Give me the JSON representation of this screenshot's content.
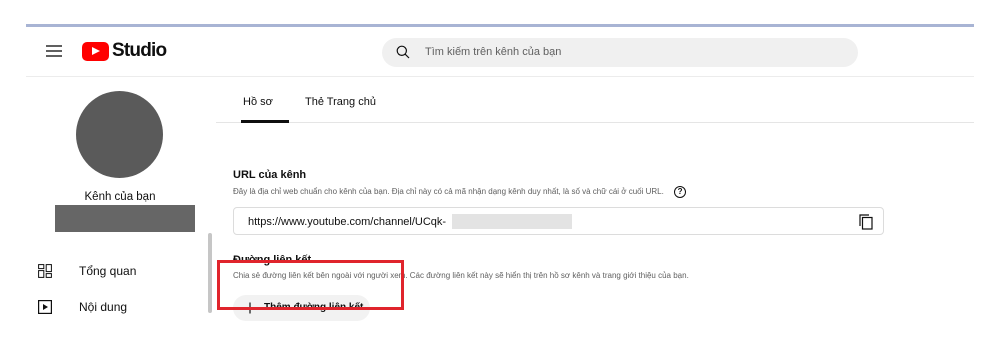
{
  "app": {
    "logo_text": "Studio",
    "search_placeholder": "Tìm kiếm trên kênh của bạn"
  },
  "sidebar": {
    "channel_label": "Kênh của bạn",
    "items": [
      {
        "label": "Tổng quan",
        "icon": "dashboard-icon"
      },
      {
        "label": "Nội dung",
        "icon": "content-icon"
      }
    ]
  },
  "tabs": [
    {
      "label": "Hồ sơ",
      "active": true
    },
    {
      "label": "Thẻ Trang chủ",
      "active": false
    }
  ],
  "channel_url": {
    "title": "URL của kênh",
    "description": "Đây là địa chỉ web chuẩn cho kênh của bạn. Địa chỉ này có cả mã nhận dạng kênh duy nhất, là số và chữ cái ở cuối URL.",
    "help_icon_text": "?",
    "value": "https://www.youtube.com/channel/UCqk-"
  },
  "links": {
    "title": "Đường liên kết",
    "description": "Chia sẻ đường liên kết bên ngoài với người xem. Các đường liên kết này sẽ hiển thị trên hồ sơ kênh và trang giới thiệu của bạn.",
    "add_button_label": "Thêm đường liên kết"
  },
  "colors": {
    "brand_red": "#ff0000",
    "highlight_red": "#e0242c",
    "avatar_gray": "#5a5a5a"
  }
}
